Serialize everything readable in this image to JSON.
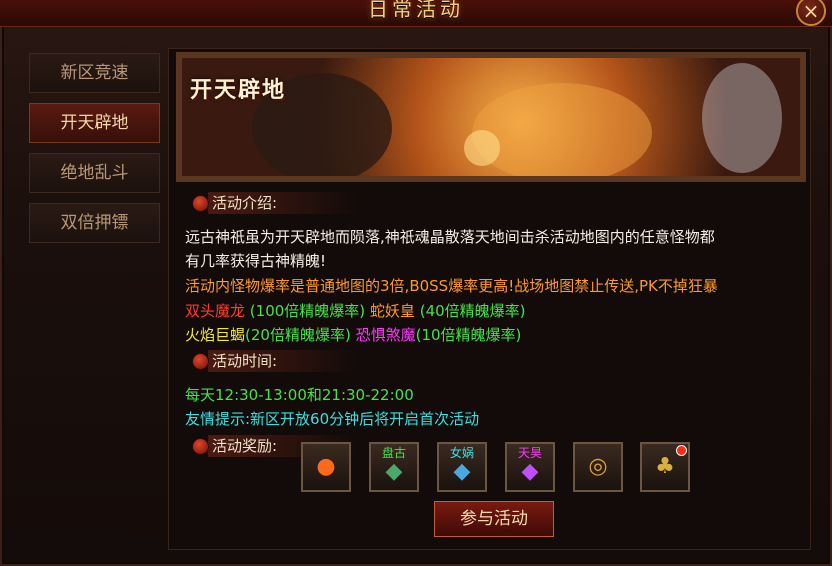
{
  "window": {
    "title": "日常活动",
    "close_label": "×"
  },
  "sidebar": {
    "items": [
      {
        "label": "新区竞速",
        "active": false
      },
      {
        "label": "开天辟地",
        "active": true
      },
      {
        "label": "绝地乱斗",
        "active": false
      },
      {
        "label": "双倍押镖",
        "active": false
      }
    ]
  },
  "banner": {
    "title": "开天辟地"
  },
  "intro": {
    "heading": "活动介绍:",
    "line1": "远古神祇虽为开天辟地而陨落,神祇魂晶散落天地间击杀活动地图内的任意怪物都",
    "line2": "有几率获得古神精魄!",
    "line3": "活动内怪物爆率是普通地图的3倍,B0SS爆率更高!战场地图禁止传送,PK不掉狂暴",
    "boss1_name": "双头魔龙",
    "boss1_rate": "(100倍精魄爆率)",
    "boss2_name": "蛇妖皇",
    "boss2_rate": "(40倍精魄爆率)",
    "boss3_name": "火焰巨蝎",
    "boss3_rate": "(20倍精魄爆率)",
    "boss4_name": "恐惧煞魔",
    "boss4_rate": "(10倍精魄爆率)"
  },
  "time": {
    "heading": "活动时间:",
    "schedule": "每天12:30-13:00和21:30-22:00",
    "tip": "友情提示:新区开放60分钟后将开启首次活动"
  },
  "rewards": {
    "heading": "活动奖励:",
    "items": [
      {
        "icon": "fire-orb-icon",
        "tag": ""
      },
      {
        "icon": "green-gem-icon",
        "tag": "盘古"
      },
      {
        "icon": "blue-gem-icon",
        "tag": "女娲"
      },
      {
        "icon": "purple-gem-icon",
        "tag": "天昊"
      },
      {
        "icon": "gold-ring-icon",
        "tag": ""
      },
      {
        "icon": "treasure-bag-icon",
        "tag": ""
      }
    ]
  },
  "join_button": "参与活动"
}
